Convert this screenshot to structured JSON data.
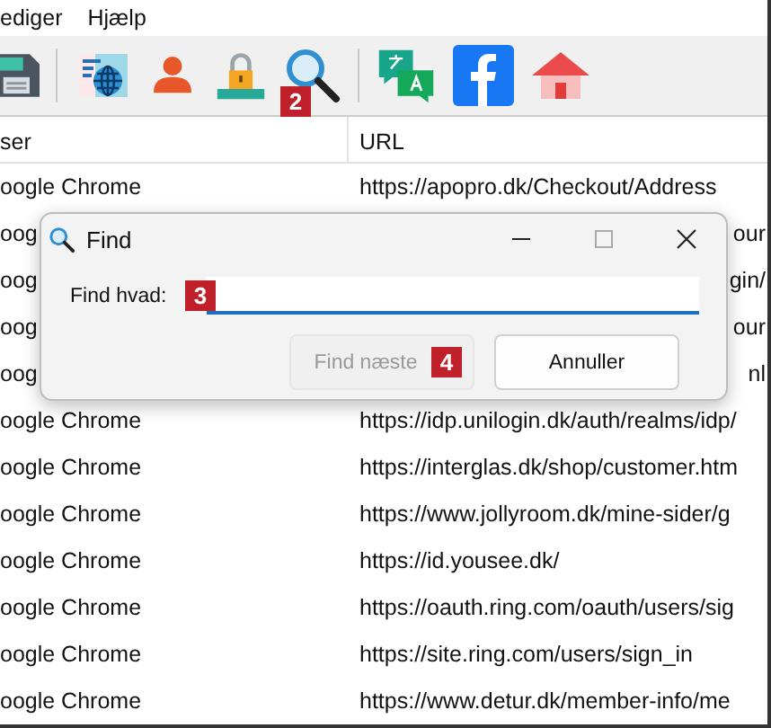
{
  "menu": [
    "ediger",
    "Hjælp"
  ],
  "toolbar": {
    "search_badge": "2"
  },
  "table": {
    "columns": [
      "ser",
      "URL"
    ],
    "rows": [
      {
        "kind": "full",
        "browser": "oogle Chrome",
        "url": "https://apopro.dk/Checkout/Address"
      },
      {
        "kind": "covered",
        "browser": "oog",
        "url": "our"
      },
      {
        "kind": "covered",
        "browser": "oog",
        "url": "gin/"
      },
      {
        "kind": "covered",
        "browser": "oog",
        "url": "our"
      },
      {
        "kind": "covered",
        "browser": "oog",
        "url": "nl"
      },
      {
        "kind": "full",
        "browser": "oogle Chrome",
        "url": "https://idp.unilogin.dk/auth/realms/idp/"
      },
      {
        "kind": "full",
        "browser": "oogle Chrome",
        "url": "https://interglas.dk/shop/customer.htm"
      },
      {
        "kind": "full",
        "browser": "oogle Chrome",
        "url": "https://www.jollyroom.dk/mine-sider/g"
      },
      {
        "kind": "full",
        "browser": "oogle Chrome",
        "url": "https://id.yousee.dk/"
      },
      {
        "kind": "full",
        "browser": "oogle Chrome",
        "url": "https://oauth.ring.com/oauth/users/sig"
      },
      {
        "kind": "full",
        "browser": "oogle Chrome",
        "url": "https://site.ring.com/users/sign_in"
      },
      {
        "kind": "full",
        "browser": "oogle Chrome",
        "url": "https://www.detur.dk/member-info/me"
      }
    ]
  },
  "dialog": {
    "title": "Find",
    "label": "Find hvad:",
    "field_badge": "3",
    "buttons": [
      {
        "label": "Find næste",
        "disabled": true,
        "badge": "4"
      },
      {
        "label": "Annuller",
        "disabled": false
      }
    ]
  }
}
